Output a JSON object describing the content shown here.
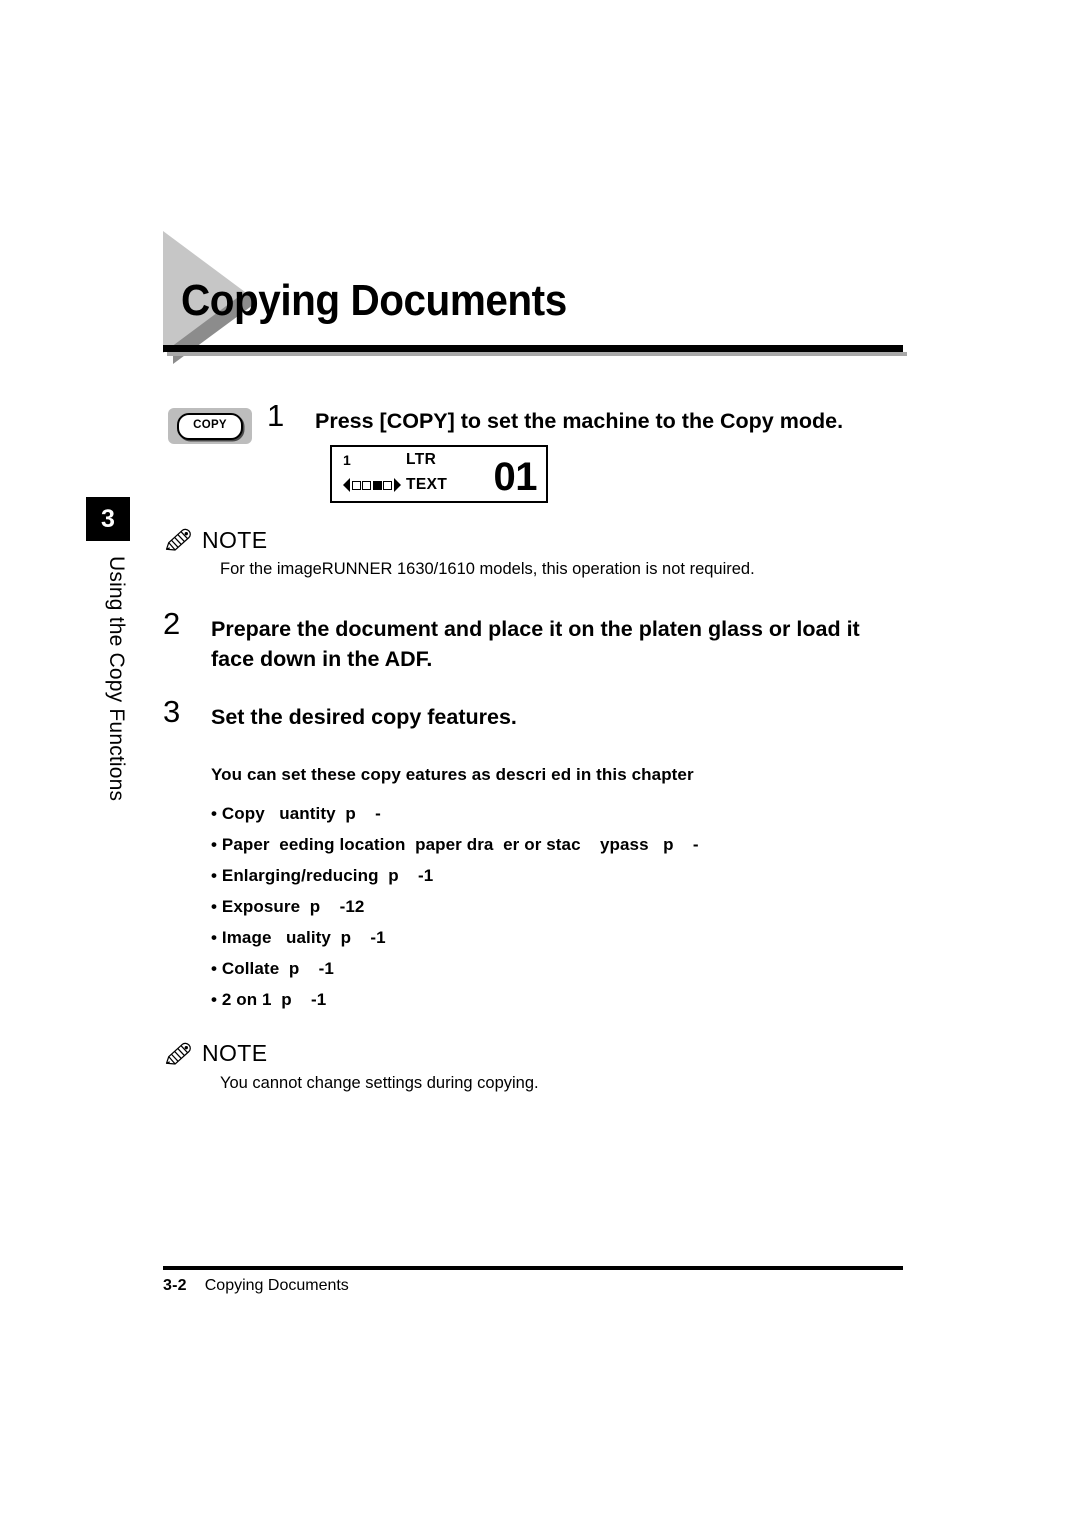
{
  "chapter_tab": {
    "number": "3",
    "vertical_label": "Using the Copy Functions"
  },
  "header": {
    "title": "Copying Documents"
  },
  "steps": [
    {
      "number": "1",
      "text": "Press [COPY] to set the machine to the Copy mode."
    },
    {
      "number": "2",
      "text": "Prepare the document and place it on the platen glass or load it face down in the ADF."
    },
    {
      "number": "3",
      "text": "Set the desired copy features."
    }
  ],
  "copy_key": {
    "label": "COPY"
  },
  "lcd": {
    "copies": "1",
    "paper_size": "LTR",
    "image_mode": "TEXT",
    "count": "01",
    "exposure_segments": [
      "empty",
      "empty",
      "filled",
      "empty"
    ],
    "left_arrow": "left-triangle",
    "right_arrow": "right-triangle"
  },
  "notes": [
    {
      "icon": "pencil-icon",
      "title": "NOTE",
      "body": "For the imageRUNNER 1630/1610 models, this operation is not required."
    },
    {
      "icon": "pencil-icon",
      "title": "NOTE",
      "body": "You cannot change settings during copying."
    }
  ],
  "features": {
    "intro": "You can set these copy  eatures  as descri  ed in this chapter",
    "items": [
      "• Copy   uantity  p    -",
      "• Paper  eeding location  paper dra  er or stac    ypass   p    -",
      "• Enlarging/reducing  p    -1",
      "• Exposure  p    -12",
      "• Image   uality  p    -1",
      "• Collate  p    -1",
      "• 2 on 1  p    -1"
    ]
  },
  "footer": {
    "page_number": "3-2",
    "title": "Copying Documents"
  }
}
